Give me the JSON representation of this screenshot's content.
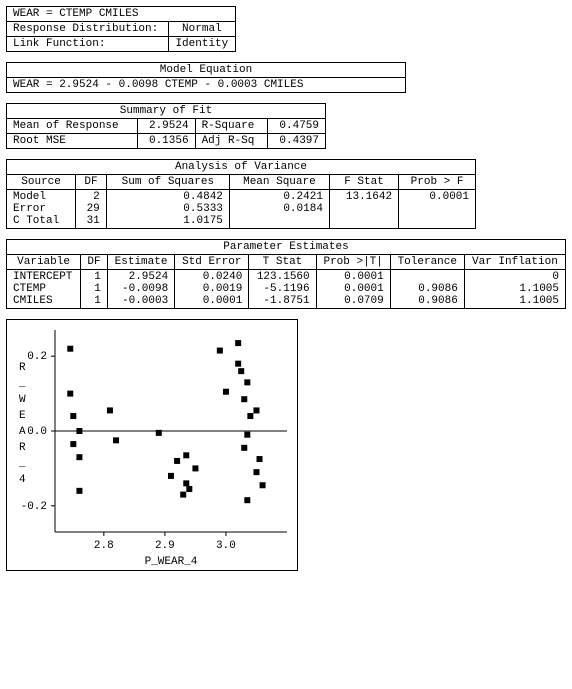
{
  "model_spec": {
    "line1": "WEAR   =   CTEMP   CMILES",
    "line2_label": "Response Distribution:",
    "line2_value": "Normal",
    "line3_label": "Link Function:",
    "line3_value": "Identity"
  },
  "model_equation": {
    "title": "Model Equation",
    "text": "WEAR   =   2.9524   -   0.0098  CTEMP   -   0.0003  CMILES"
  },
  "summary_fit": {
    "title": "Summary of Fit",
    "rows": [
      {
        "l1": "Mean of Response",
        "v1": "2.9524",
        "l2": "R-Square",
        "v2": "0.4759"
      },
      {
        "l1": "Root MSE",
        "v1": "0.1356",
        "l2": "Adj R-Sq",
        "v2": "0.4397"
      }
    ]
  },
  "anova": {
    "title": "Analysis of Variance",
    "headers": [
      "Source",
      "DF",
      "Sum of Squares",
      "Mean Square",
      "F Stat",
      "Prob > F"
    ],
    "rows": [
      [
        "Model",
        "2",
        "0.4842",
        "0.2421",
        "13.1642",
        "0.0001"
      ],
      [
        "Error",
        "29",
        "0.5333",
        "0.0184",
        "",
        ""
      ],
      [
        "C Total",
        "31",
        "1.0175",
        "",
        "",
        ""
      ]
    ]
  },
  "param_est": {
    "title": "Parameter Estimates",
    "headers": [
      "Variable",
      "DF",
      "Estimate",
      "Std Error",
      "T Stat",
      "Prob >|T|",
      "Tolerance",
      "Var Inflation"
    ],
    "rows": [
      [
        "INTERCEPT",
        "1",
        "2.9524",
        "0.0240",
        "123.1560",
        "0.0001",
        "",
        "0"
      ],
      [
        "CTEMP",
        "1",
        "-0.0098",
        "0.0019",
        "-5.1196",
        "0.0001",
        "0.9086",
        "1.1005"
      ],
      [
        "CMILES",
        "1",
        "-0.0003",
        "0.0001",
        "-1.8751",
        "0.0709",
        "0.9086",
        "1.1005"
      ]
    ]
  },
  "chart_data": {
    "type": "scatter",
    "xlabel": "P_WEAR_4",
    "ylabel": "R_WEAR_4",
    "xlim": [
      2.72,
      3.1
    ],
    "ylim": [
      -0.27,
      0.27
    ],
    "xticks": [
      2.8,
      2.9,
      3.0
    ],
    "yticks": [
      -0.2,
      0.0,
      0.2
    ],
    "points": [
      [
        2.745,
        0.22
      ],
      [
        2.745,
        0.1
      ],
      [
        2.75,
        0.04
      ],
      [
        2.76,
        0.0
      ],
      [
        2.75,
        -0.035
      ],
      [
        2.76,
        -0.07
      ],
      [
        2.76,
        -0.16
      ],
      [
        2.81,
        0.055
      ],
      [
        2.82,
        -0.025
      ],
      [
        2.89,
        -0.005
      ],
      [
        2.91,
        -0.12
      ],
      [
        2.92,
        -0.08
      ],
      [
        2.93,
        -0.17
      ],
      [
        2.935,
        -0.14
      ],
      [
        2.94,
        -0.155
      ],
      [
        2.935,
        -0.065
      ],
      [
        2.95,
        -0.1
      ],
      [
        2.99,
        0.215
      ],
      [
        3.0,
        0.105
      ],
      [
        3.02,
        0.235
      ],
      [
        3.02,
        0.18
      ],
      [
        3.025,
        0.16
      ],
      [
        3.035,
        0.13
      ],
      [
        3.03,
        0.085
      ],
      [
        3.04,
        0.04
      ],
      [
        3.035,
        -0.01
      ],
      [
        3.03,
        -0.045
      ],
      [
        3.05,
        0.055
      ],
      [
        3.055,
        -0.075
      ],
      [
        3.05,
        -0.11
      ],
      [
        3.06,
        -0.145
      ],
      [
        3.035,
        -0.185
      ]
    ]
  }
}
